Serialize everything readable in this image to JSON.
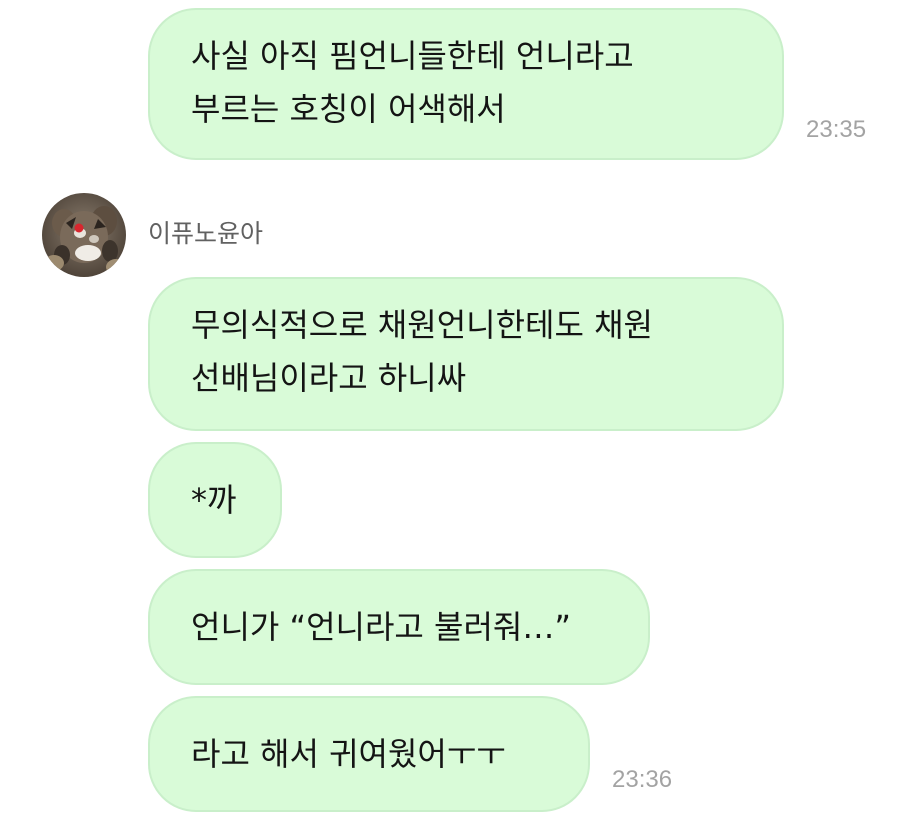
{
  "messages": [
    {
      "lines": [
        "사실 아직 핌언니들한테 언니라고",
        "부르는 호칭이 어색해서"
      ],
      "time": "23:35"
    },
    {
      "sender": "이퓨노윤아",
      "lines": [
        "무의식적으로 채원언니한테도 채원",
        "선배님이라고 하니싸"
      ]
    },
    {
      "lines": [
        "*까"
      ]
    },
    {
      "lines": [
        "언니가 “언니라고 불러줘…”"
      ]
    },
    {
      "lines": [
        "라고 해서 귀여웠어ㅜㅜ"
      ],
      "time": "23:36"
    }
  ],
  "avatar_icon": "profile-photo-plush-toy",
  "colors": {
    "bubble_fill": "#d9fbd8",
    "bubble_border": "#c9efca",
    "time_text": "#a3a3a3",
    "sender_text": "#616161"
  }
}
